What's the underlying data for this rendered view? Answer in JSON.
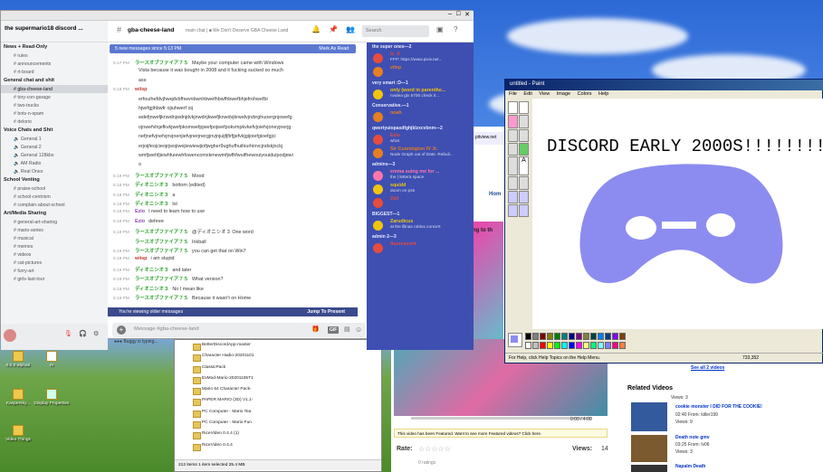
{
  "discord": {
    "title": "the supermario18 discord ...",
    "server_name": "the supermario18 discord ...",
    "channel_name": "gba-cheese-land",
    "topic": "main chat | ■ We Don't Deserve GBA Cheese Land",
    "search_placeholder": "Search",
    "new_messages": "5 new messages since 5:13 PM",
    "mark_as_read": "Mark As Read",
    "categories": [
      {
        "name": "News + Read-Only",
        "channels": [
          "rules",
          "announcements",
          "rt-board"
        ]
      },
      {
        "name": "General chat and shit",
        "channels": [
          "gba-cheese-land",
          "tory-con-garage",
          "two-trucks",
          "bots-n-spam",
          "delorio"
        ]
      },
      {
        "name": "Voice Chats and Shit",
        "channels": [
          "General 1",
          "General 2",
          "General 128kbs",
          "AM Radio",
          "Real Ones"
        ]
      },
      {
        "name": "School Venting",
        "channels": [
          "praise-school",
          "school-centrism",
          "complain-about-school"
        ]
      },
      {
        "name": "Art/Media Sharing",
        "channels": [
          "general-art-sharing",
          "mario-series",
          "musical",
          "memes",
          "videos",
          "cat-pictures",
          "furry-art",
          "girls-last-tour"
        ]
      }
    ],
    "messages": [
      {
        "time": "5:17 PM",
        "author": "ラースオブファイア７５",
        "color": "#2aa12a",
        "text": "Maybe your computer came with Windows"
      },
      {
        "time": "",
        "author": "",
        "color": "#333",
        "text": "Vista because it was bought in 2008 and it fucking sucked so much"
      },
      {
        "time": "",
        "author": "",
        "color": "#333",
        "text": "ass"
      },
      {
        "time": "5:18 PM",
        "author": "wiisp",
        "color": "#c0392b",
        "text": ""
      },
      {
        "time": "",
        "author": "",
        "color": "#333",
        "text": "erfouihefdvjhwqdvbfhwvnbwnhbwefhbwfhbwefbhjefrohwefbi"
      },
      {
        "time": "",
        "author": "",
        "color": "#333",
        "text": "hjwrfgjihbwfr ojiuhwerf oij"
      },
      {
        "time": "",
        "author": "",
        "color": "#333",
        "text": "wdefjnwefjknwdnjwdnjdvkjnwdnjkwefjknwdvjknwdvjrvbrghuoergnjowefg"
      },
      {
        "time": "",
        "author": "",
        "color": "#333",
        "text": "ojnwefvlnjefkvkjwefpkomwefpjwefpojwefpokvmpkvkefvjoiefvjoneyjnerjg"
      },
      {
        "time": "",
        "author": "",
        "color": "#333",
        "text": "nefjnefvjnefvjnvjnenjiefvjnerjnergjnvjnjuijfjfirfjjefvkjgijoiefgioefgjci"
      },
      {
        "time": "",
        "author": "",
        "color": "#333",
        "text": "erjoijfeojcieojrjwojiwejiewiewjiofjwgher9ughufhuihiurhinvcjndskjnckj"
      },
      {
        "time": "",
        "author": "",
        "color": "#333",
        "text": "wmfjwehfjiewhfuiewhfowencomxkmewmfjwfhfwuifhewouiyouiduipodjewi"
      },
      {
        "time": "",
        "author": "",
        "color": "#333",
        "text": "o"
      },
      {
        "time": "5:18 PM",
        "author": "ラースオブファイア７５",
        "color": "#2aa12a",
        "text": "Mood"
      },
      {
        "time": "5:18 PM",
        "author": "ディオニシオ３",
        "color": "#2aa12a",
        "text": "bottom (edited)"
      },
      {
        "time": "5:18 PM",
        "author": "ディオニシオ３",
        "color": "#2aa12a",
        "text": "a"
      },
      {
        "time": "5:18 PM",
        "author": "ディオニシオ３",
        "color": "#2aa12a",
        "text": "lol"
      },
      {
        "time": "5:18 PM",
        "author": "Ezio",
        "color": "#8e44ad",
        "text": "I need to learn how to use"
      },
      {
        "time": "5:18 PM",
        "author": "Ezio",
        "color": "#8e44ad",
        "text": "dehree"
      },
      {
        "time": "5:18 PM",
        "author": "ラースオブファイア７５",
        "color": "#2aa12a",
        "text": "@ディオニシオ３ One word"
      },
      {
        "time": "",
        "author": "ラースオブファイア７５",
        "color": "#2aa12a",
        "text": "Inkball"
      },
      {
        "time": "5:19 PM",
        "author": "ラースオブファイア７５",
        "color": "#2aa12a",
        "text": "you can get that on Win7"
      },
      {
        "time": "5:19 PM",
        "author": "wiisp",
        "color": "#c0392b",
        "text": "i am stupid"
      },
      {
        "time": "5:19 PM",
        "author": "ディオニシオ３",
        "color": "#2aa12a",
        "text": "and later"
      },
      {
        "time": "5:19 PM",
        "author": "ラースオブファイア７５",
        "color": "#2aa12a",
        "text": "What version?"
      },
      {
        "time": "5:19 PM",
        "author": "ディオニシオ３",
        "color": "#2aa12a",
        "text": "No I mean like"
      },
      {
        "time": "5:19 PM",
        "author": "ラースオブファイア７５",
        "color": "#2aa12a",
        "text": "Because it wasn't on Home"
      }
    ],
    "older_notice": "You're viewing older messages",
    "jump_to_present": "Jump To Present",
    "composer_placeholder": "Message #gba-cheese-land",
    "typing": "Buggy is typing...",
    "member_groups": [
      {
        "name": "the super ones—2",
        "members": [
          {
            "name": "ic_tl",
            "status": "FFP: https://www.pixiv.net...",
            "color": "#e74c3c"
          },
          {
            "name": "vilep",
            "status": "",
            "color": "#e67e22"
          }
        ]
      },
      {
        "name": "very smart :D—1",
        "members": [
          {
            "name": "only (word in parenthe...",
            "status": "nvidea gtx 5700 check it...",
            "color": "#f1c40f"
          }
        ]
      },
      {
        "name": "Conservative.—1",
        "members": [
          {
            "name": "noah",
            "status": "",
            "color": "#e67e22"
          }
        ]
      },
      {
        "name": "qwertyuiopasdfghjklzxcvbnm—2",
        "members": [
          {
            "name": "Ezio",
            "status": "what",
            "color": "#e74c3c"
          },
          {
            "name": "Sir Cunnington IV Jr.",
            "status": "Node Graph out of Date. Rebuil...",
            "color": "#e67e22"
          }
        ]
      },
      {
        "name": "admins—3",
        "members": [
          {
            "name": "emma suing me for ...",
            "status": "the | lettera space",
            "color": "#ff77aa"
          },
          {
            "name": "squidd",
            "status": "doom on ps5",
            "color": "#f1c40f"
          },
          {
            "name": "Zell",
            "status": "",
            "color": "#e74c3c"
          }
        ]
      },
      {
        "name": "BIGGEST—1",
        "members": [
          {
            "name": "Zarudicus",
            "status": "at the illinas roblox concert",
            "color": "#f1c40f"
          }
        ]
      },
      {
        "name": "admin 2—3",
        "members": [
          {
            "name": "fluorescent",
            "status": "",
            "color": "#e74c3c"
          }
        ]
      }
    ]
  },
  "paint": {
    "title": "untitled - Paint",
    "menus": [
      "File",
      "Edit",
      "View",
      "Image",
      "Colors",
      "Help"
    ],
    "canvas_text": "DISCORD EARLY 2000S!!!!!!!!!",
    "status": "For Help, click Help Topics on the Help Menu.",
    "coords": "733,352",
    "palette": [
      "#000000",
      "#808080",
      "#800000",
      "#808000",
      "#008000",
      "#008080",
      "#000080",
      "#800080",
      "#808040",
      "#004040",
      "#0080ff",
      "#004080",
      "#8000ff",
      "#804000",
      "#ffffff",
      "#c0c0c0",
      "#ff0000",
      "#ffff00",
      "#00ff00",
      "#00ffff",
      "#0000ff",
      "#ff00ff",
      "#ffff80",
      "#00ff80",
      "#80ffff",
      "#8080ff",
      "#ff0080",
      "#ff8040"
    ],
    "blob_color": "#8c8cf0"
  },
  "explorer": {
    "files": [
      "BetterDiscordApp-master",
      "Character Hadio-20201101",
      "ClassicPack",
      "ExMod-Mario-20201105T1",
      "Mario 64 Character Pack-",
      "PAPER MARIO (3D) V1.1-",
      "PC Computer - Mario Tea",
      "PC Computer - Mario Fun",
      "RiceVideo 0.4.4 (1)",
      "RiceVideo 0.4.4"
    ],
    "status": "212 items   1 item selected  25.4 MB"
  },
  "video": {
    "time": "0:00 / 4:00",
    "featured": "This video has been Featured. Want to see more Featured videos? Click here.",
    "rate_label": "Rate:",
    "views_label": "Views:",
    "views": "14",
    "ratings": "0 ratings"
  },
  "related": {
    "see_all": "See all 2 videos",
    "header": "Related Videos",
    "items": [
      {
        "title": "",
        "line1": "Views: 3"
      },
      {
        "title": "cookie monster I DID FOR THE COOKIE!",
        "line1": "02:40 From: killer199",
        "line2": "Views: 9"
      },
      {
        "title": "Death note gmv",
        "line1": "03:25 From: lv06",
        "line2": "Views: 3"
      },
      {
        "title": "Napalm Death",
        "line1": "",
        "line2": ""
      }
    ]
  },
  "desktop": {
    "icons": [
      "0.0.0-alpha2",
      "m",
      "Kaspersky...",
      "Display Properties",
      "Video Things"
    ]
  },
  "browser_bits": {
    "url": "pitview.net",
    "home": "Hom",
    "ng_to": "ng to th"
  }
}
